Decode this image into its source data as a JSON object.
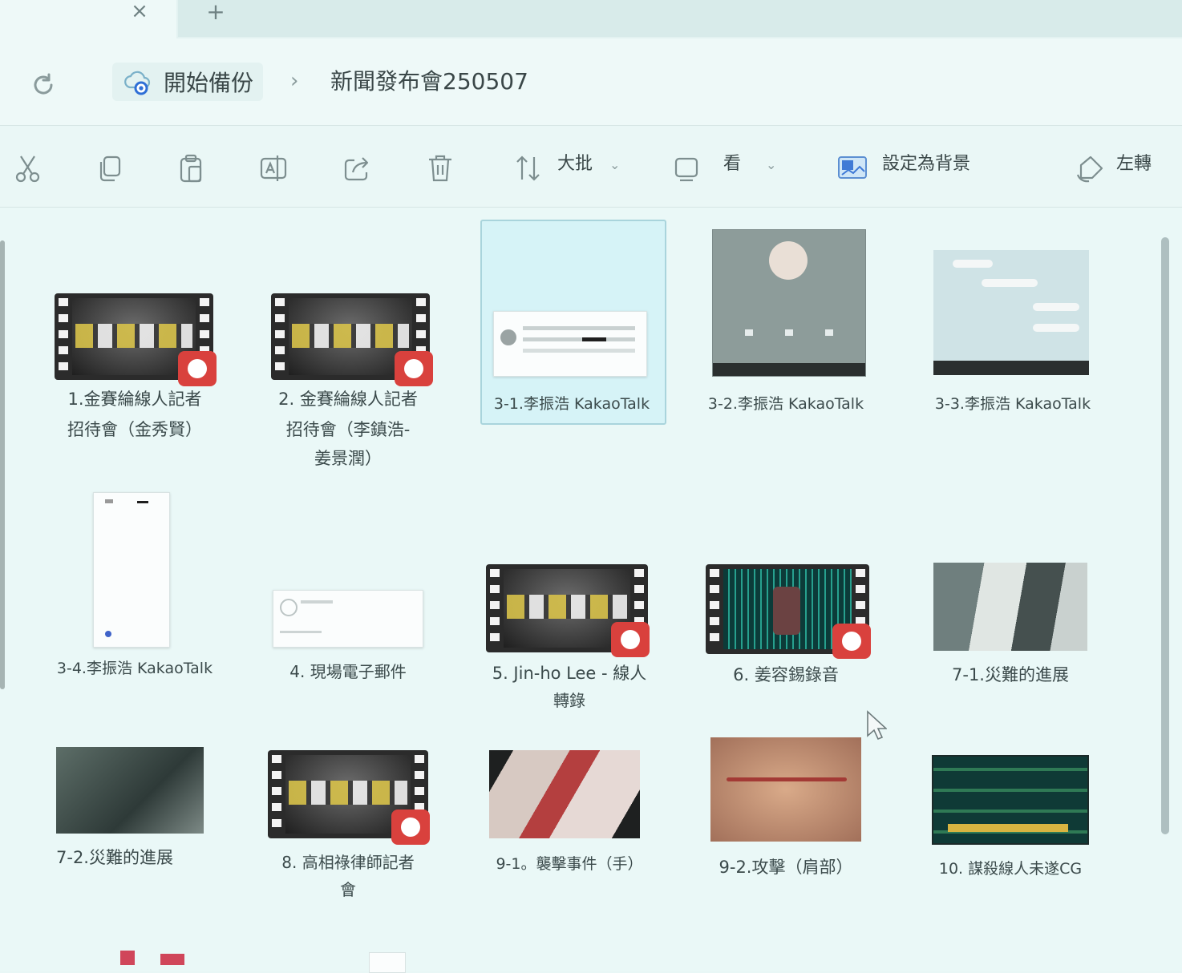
{
  "tabs": {
    "close_glyph": "×",
    "new_glyph": "+"
  },
  "breadcrumb": {
    "root": "開始備份",
    "separator": "›",
    "current": "新聞發布會250507"
  },
  "toolbar": {
    "sort_label": "大批",
    "view_label": "看",
    "set_background_label": "設定為背景",
    "rotate_left_label": "左轉",
    "icons": [
      "cut-icon",
      "copy-icon",
      "paste-icon",
      "rename-icon",
      "share-icon",
      "delete-icon",
      "sort-icon",
      "view-icon",
      "set-background-icon",
      "rotate-left-icon"
    ]
  },
  "files": [
    {
      "name": "1.金賽綸線人記者招待會（金秀賢）",
      "kind": "video"
    },
    {
      "name": "2. 金賽綸線人記者招待會（李鎮浩-姜景潤）",
      "kind": "video"
    },
    {
      "name": "3-1.李振浩 KakaoTalk",
      "kind": "image",
      "selected": true
    },
    {
      "name": "3-2.李振浩 KakaoTalk",
      "kind": "image"
    },
    {
      "name": "3-3.李振浩 KakaoTalk",
      "kind": "image"
    },
    {
      "name": "3-4.李振浩 KakaoTalk",
      "kind": "image"
    },
    {
      "name": "4. 現場電子郵件",
      "kind": "image"
    },
    {
      "name": "5. Jin-ho Lee - 線人轉錄",
      "kind": "video"
    },
    {
      "name": "6. 姜容錫錄音",
      "kind": "video"
    },
    {
      "name": "7-1.災難的進展",
      "kind": "image"
    },
    {
      "name": "7-2.災難的進展",
      "kind": "image"
    },
    {
      "name": "8. 高相祿律師記者會",
      "kind": "video"
    },
    {
      "name": "9-1。襲擊事件（手）",
      "kind": "image"
    },
    {
      "name": "9-2.攻擊（肩部）",
      "kind": "image"
    },
    {
      "name": "10. 謀殺線人未遂CG",
      "kind": "image"
    }
  ],
  "captions": {
    "f1_l1": "1.金賽綸線人記者",
    "f1_l2": "招待會（金秀賢）",
    "f2_l1": "2. 金賽綸線人記者",
    "f2_l2": "招待會（李鎮浩-",
    "f2_l3": "姜景潤）",
    "f3": "3-1.李振浩 KakaoTalk",
    "f4": "3-2.李振浩 KakaoTalk",
    "f5": "3-3.李振浩 KakaoTalk",
    "f6": "3-4.李振浩 KakaoTalk",
    "f7": "4. 現場電子郵件",
    "f8_l1": "5. Jin-ho Lee - 線人",
    "f8_l2": "轉錄",
    "f9": "6. 姜容錫錄音",
    "f10": "7-1.災難的進展",
    "f11": "7-2.災難的進展",
    "f12_l1": "8. 高相祿律師記者",
    "f12_l2": "會",
    "f13": "9-1。襲擊事件（手）",
    "f14": "9-2.攻擊（肩部）",
    "f15": "10. 謀殺線人未遂CG"
  }
}
